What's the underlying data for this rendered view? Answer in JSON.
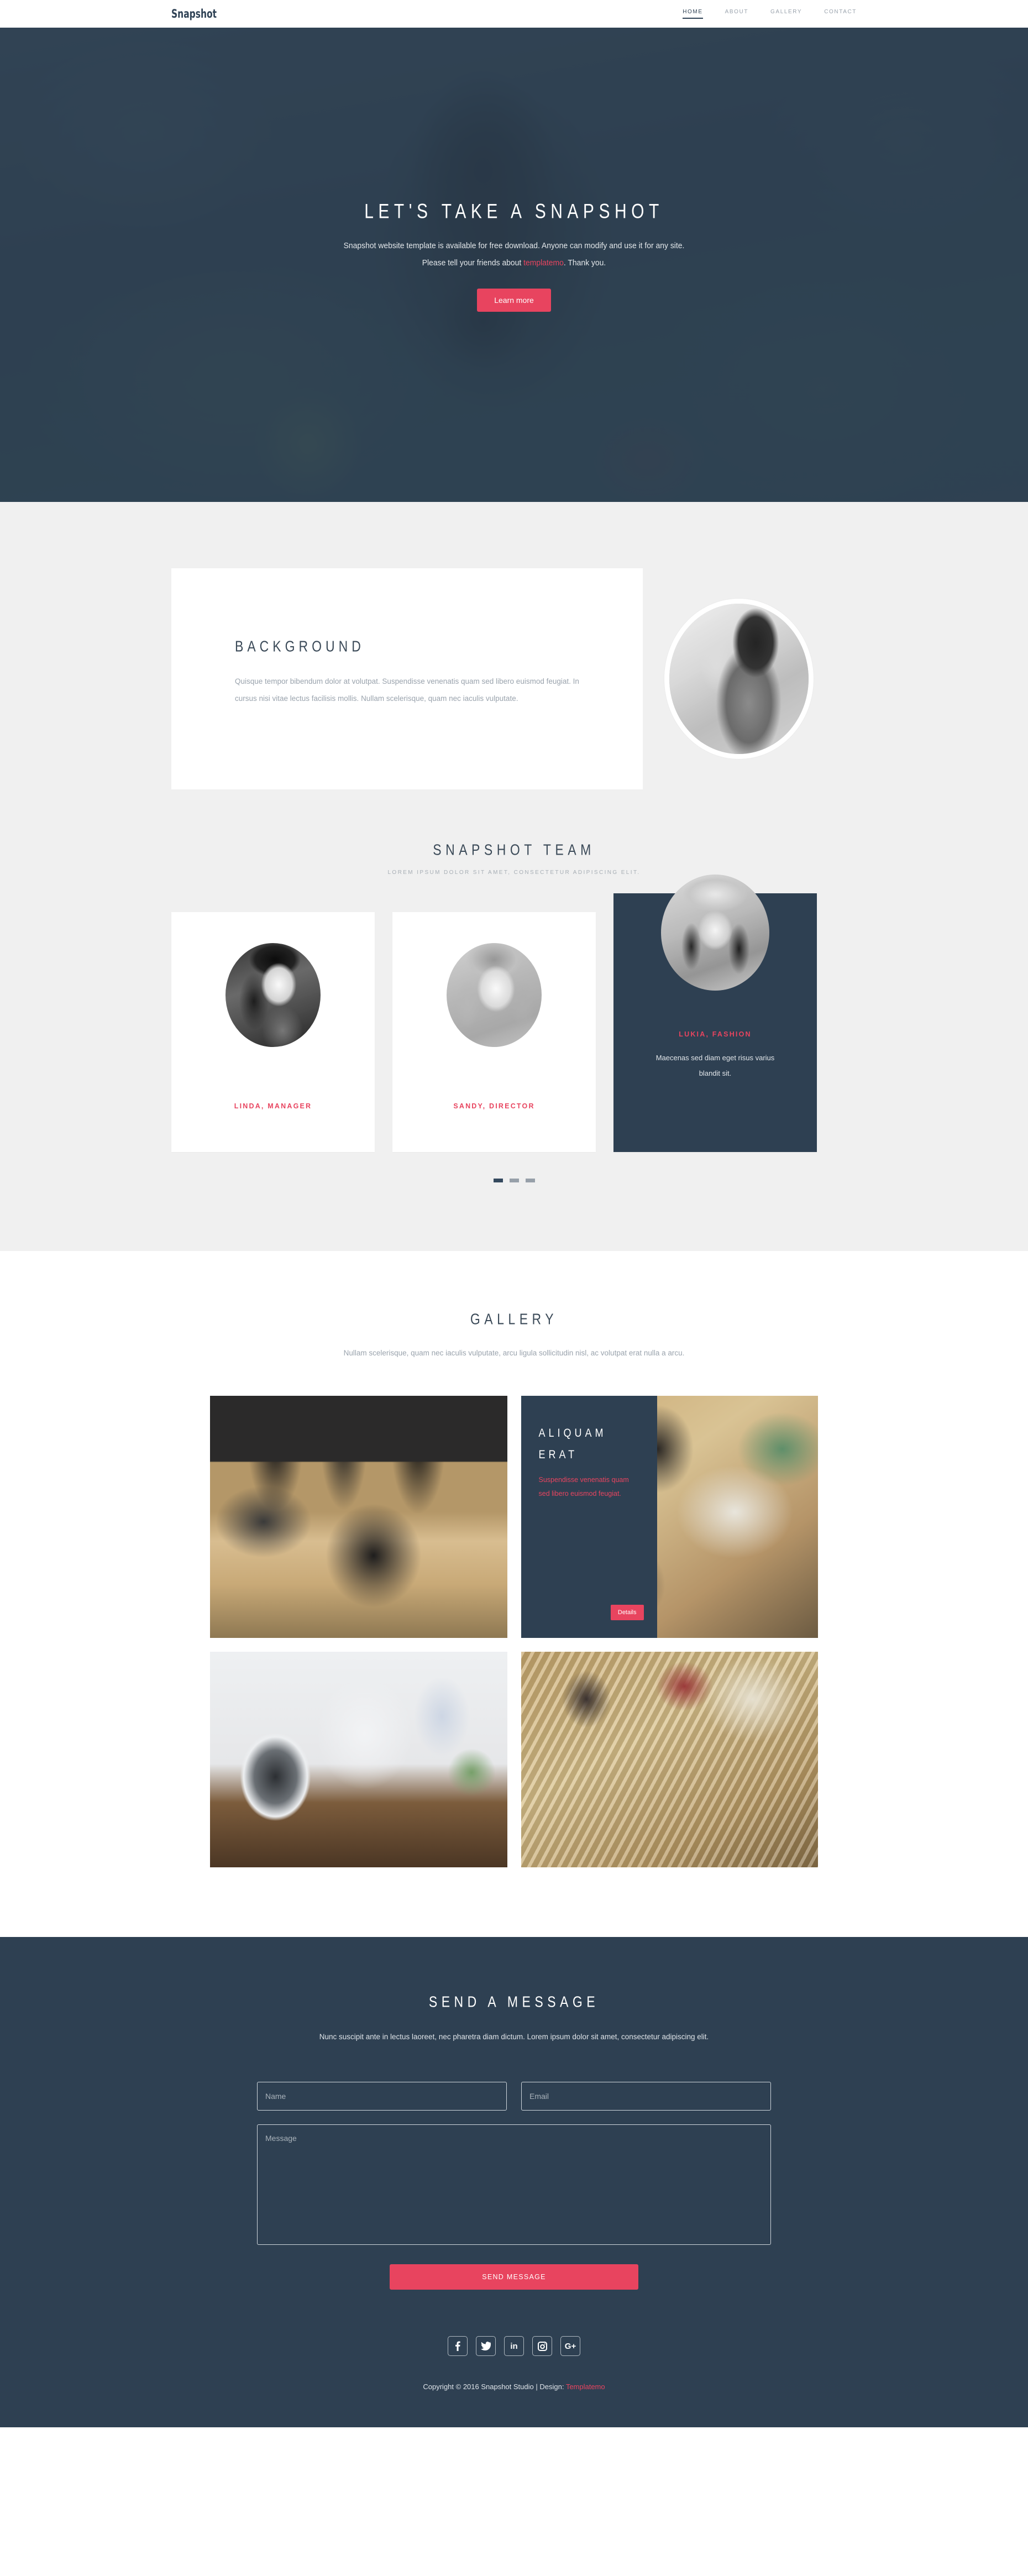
{
  "brand": "Snapshot",
  "nav": {
    "items": [
      {
        "label": "HOME",
        "active": true
      },
      {
        "label": "ABOUT",
        "active": false
      },
      {
        "label": "GALLERY",
        "active": false
      },
      {
        "label": "CONTACT",
        "active": false
      }
    ]
  },
  "hero": {
    "title": "LET'S TAKE A SNAPSHOT",
    "line1": "Snapshot website template is available for free download. Anyone can modify and use it for any site.",
    "line2_before": "Please tell your friends about ",
    "line2_link": "templatemo",
    "line2_after": ". Thank you.",
    "cta": "Learn more"
  },
  "background": {
    "heading": "BACKGROUND",
    "text": "Quisque tempor bibendum dolor at volutpat. Suspendisse venenatis quam sed libero euismod feugiat. In cursus nisi vitae lectus facilisis mollis. Nullam scelerisque, quam nec iaculis vulputate."
  },
  "team": {
    "heading": "SNAPSHOT TEAM",
    "subheading": "LOREM IPSUM DOLOR SIT AMET, CONSECTETUR ADIPISCING ELIT.",
    "members": [
      {
        "name": "LINDA, MANAGER",
        "desc": ""
      },
      {
        "name": "SANDY, DIRECTOR",
        "desc": ""
      },
      {
        "name": "LUKIA, FASHION",
        "desc": "Maecenas sed diam eget risus varius blandit sit."
      }
    ],
    "dots": [
      {
        "active": true
      },
      {
        "active": false
      },
      {
        "active": false
      }
    ]
  },
  "gallery": {
    "heading": "GALLERY",
    "subheading": "Nullam scelerisque, quam nec iaculis vulputate, arcu ligula sollicitudin nisl, ac volutpat erat nulla a arcu.",
    "overlay": {
      "title_line1": "ALIQUAM",
      "title_line2": "ERAT",
      "text": "Suspendisse venenatis quam sed libero euismod feugiat.",
      "button": "Details"
    }
  },
  "contact": {
    "heading": "SEND A MESSAGE",
    "subheading": "Nunc suscipit ante in lectus laoreet, nec pharetra diam dictum. Lorem ipsum dolor sit amet, consectetur adipiscing elit.",
    "name_placeholder": "Name",
    "name_value": "",
    "email_placeholder": "Email",
    "email_value": "",
    "message_placeholder": "Message",
    "message_value": "",
    "submit": "SEND MESSAGE"
  },
  "footer": {
    "socials": [
      {
        "name": "facebook",
        "glyph": "f"
      },
      {
        "name": "twitter",
        "glyph": ""
      },
      {
        "name": "linkedin",
        "glyph": "in"
      },
      {
        "name": "instagram",
        "glyph": ""
      },
      {
        "name": "google-plus",
        "glyph": "G+"
      }
    ],
    "copyright_before": "Copyright © 2016 Snapshot Studio | Design: ",
    "copyright_link": "Templatemo"
  },
  "colors": {
    "accent": "#e8445f",
    "dark": "#2e4052",
    "light_gray": "#f0f0f0",
    "muted_text": "#9aa3ad"
  }
}
